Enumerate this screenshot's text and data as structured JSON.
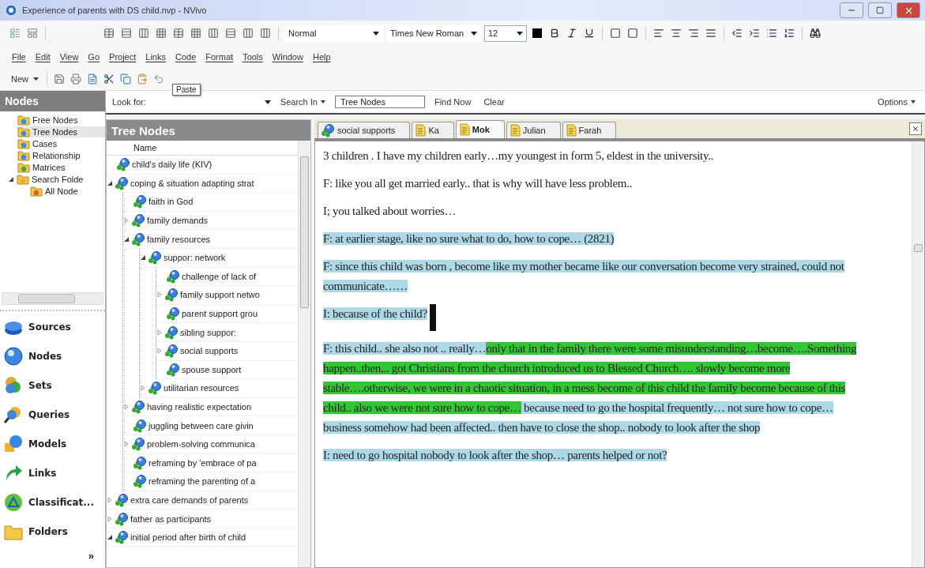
{
  "window": {
    "title": "Experience of parents with DS child.nvp - NVivo"
  },
  "format_toolbar": {
    "style": "Normal",
    "font": "Times New Roman",
    "size": "12"
  },
  "menu": [
    "File",
    "Edit",
    "View",
    "Go",
    "Project",
    "Links",
    "Code",
    "Format",
    "Tools",
    "Window",
    "Help"
  ],
  "main_toolbar": {
    "new_button": "New",
    "tooltip": "Paste"
  },
  "nav_pane": {
    "title": "Nodes",
    "folders": [
      {
        "label": "Free Nodes",
        "kind": "free",
        "selected": false
      },
      {
        "label": "Tree Nodes",
        "kind": "tree",
        "selected": true
      },
      {
        "label": "Cases",
        "kind": "cases",
        "selected": false
      },
      {
        "label": "Relationship",
        "kind": "relationship",
        "selected": false
      },
      {
        "label": "Matrices",
        "kind": "matrices",
        "selected": false
      },
      {
        "label": "Search Folde",
        "kind": "search",
        "selected": false,
        "expanded": true,
        "children": [
          {
            "label": "All Node",
            "kind": "search-item",
            "selected": false
          }
        ]
      }
    ],
    "sections": [
      {
        "label": "Sources",
        "kind": "sources"
      },
      {
        "label": "Nodes",
        "kind": "nodes"
      },
      {
        "label": "Sets",
        "kind": "sets"
      },
      {
        "label": "Queries",
        "kind": "queries"
      },
      {
        "label": "Models",
        "kind": "models"
      },
      {
        "label": "Links",
        "kind": "links"
      },
      {
        "label": "Classificat...",
        "kind": "classifications"
      },
      {
        "label": "Folders",
        "kind": "folders"
      }
    ],
    "more": "»"
  },
  "find_bar": {
    "look_for_label": "Look for:",
    "search_in": "Search In",
    "search_in_value": "Tree Nodes",
    "find_now": "Find Now",
    "clear": "Clear",
    "options": "Options"
  },
  "tree": {
    "title": "Tree Nodes",
    "column": "Name",
    "items": [
      {
        "label": "child's daily life (KIV)"
      },
      {
        "label": "coping & situation adapting strat",
        "expanded": true,
        "children": [
          {
            "label": "faith in God"
          },
          {
            "label": "family demands",
            "expanded": false
          },
          {
            "label": "family resources",
            "expanded": true,
            "children": [
              {
                "label": "suppor: network",
                "expanded": true,
                "children": [
                  {
                    "label": "challenge of lack of"
                  },
                  {
                    "label": "family support netwo",
                    "expanded": false
                  },
                  {
                    "label": "parent support grou"
                  },
                  {
                    "label": "sibling suppor:",
                    "expanded": false
                  },
                  {
                    "label": "social supports",
                    "expanded": false
                  },
                  {
                    "label": "spouse support"
                  }
                ]
              },
              {
                "label": "utilitarian resources",
                "expanded": false
              }
            ]
          },
          {
            "label": "having realistic expectation",
            "expanded": false
          },
          {
            "label": "juggling between care givin"
          },
          {
            "label": "problem-solving communica",
            "expanded": false
          },
          {
            "label": "reframing by 'embrace of pa"
          },
          {
            "label": "reframing the parenting of a"
          }
        ]
      },
      {
        "label": "extra care demands of parents",
        "expanded": false
      },
      {
        "label": "father as participants",
        "expanded": false
      },
      {
        "label": "initial period after birth of child",
        "expanded": true
      }
    ]
  },
  "detail": {
    "tabs": [
      {
        "label": "social supports",
        "kind": "node",
        "selected": false
      },
      {
        "label": "Ka",
        "kind": "document",
        "selected": false
      },
      {
        "label": "Mok",
        "kind": "document",
        "selected": true
      },
      {
        "label": "Julian",
        "kind": "document",
        "selected": false
      },
      {
        "label": "Farah",
        "kind": "document",
        "selected": false
      }
    ],
    "paragraphs": [
      {
        "cursor": false,
        "segments": [
          {
            "text": "3 children . I have my children early…my youngest in form 5, eldest in the university.."
          }
        ]
      },
      {
        "cursor": false,
        "segments": [
          {
            "text": "F: like you all get married early.. that is why  will have less problem.."
          }
        ]
      },
      {
        "cursor": false,
        "segments": [
          {
            "text": "I; you talked about worries…"
          }
        ]
      },
      {
        "cursor": false,
        "segments": [
          {
            "text": "F: at earlier stage, like  no sure what to do, how to cope…  (2821)",
            "color": "#add8e6"
          }
        ]
      },
      {
        "cursor": false,
        "segments": [
          {
            "text": "F: since this child was born , become  like    my mother    became like  our conversation become very strained, could not communicate……",
            "color": "#add8e6"
          }
        ]
      },
      {
        "cursor": true,
        "segments": [
          {
            "text": "I: because of the child?",
            "color": "#add8e6"
          }
        ]
      },
      {
        "cursor": false,
        "segments": [
          {
            "text": "F: this child.. she also not .. really…",
            "color": "#add8e6"
          },
          {
            "text": "only that in the family there were some misunderstanding…become….Something happen..then,.. got Christians from the church introduced us to Blessed Church…. slowly become more stable….otherwise, we were  in a chaotic situation, in a mess    become of this child          the family     become      because of this child..  also we were not sure how to cope…",
            "color": "#33c633"
          },
          {
            "text": " because need to go the hospital frequently… not sure how to cope… business somehow had been  affected..  then have to close the shop.. nobody to look after the shop",
            "color": "#add8e6"
          }
        ]
      },
      {
        "cursor": false,
        "segments": [
          {
            "text": "I: need to go hospital nobody to look after the shop… parents helped or not?",
            "color": "#add8e6"
          }
        ]
      }
    ]
  }
}
